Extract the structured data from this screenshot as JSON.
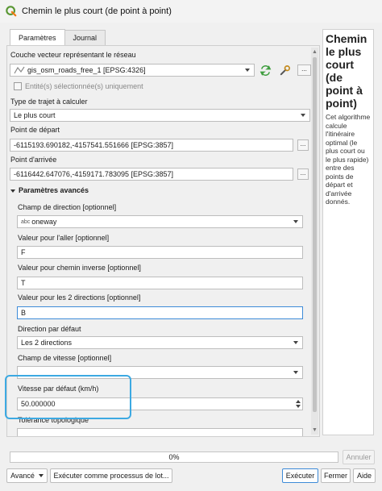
{
  "window": {
    "title": "Chemin le plus court (de point à point)"
  },
  "tabs": [
    {
      "label": "Paramètres"
    },
    {
      "label": "Journal"
    }
  ],
  "form": {
    "network_layer_label": "Couche vecteur représentant le réseau",
    "network_layer_value": "gis_osm_roads_free_1 [EPSG:4326]",
    "selected_only_label": "Entité(s) sélectionnée(s) uniquement",
    "path_type_label": "Type de trajet à calculer",
    "path_type_value": "Le plus court",
    "start_point_label": "Point de départ",
    "start_point_value": "-6115193.690182,-4157541.551666 [EPSG:3857]",
    "end_point_label": "Point d'arrivée",
    "end_point_value": "-6116442.647076,-4159171.783095 [EPSG:3857]",
    "advanced_label": "Paramètres avancés",
    "direction_field_label": "Champ de direction [optionnel]",
    "direction_field_prefix": "abc",
    "direction_field_value": "oneway",
    "forward_label": "Valeur pour l'aller [optionnel]",
    "forward_value": "F",
    "backward_label": "Valeur pour chemin inverse [optionnel]",
    "backward_value": "T",
    "both_label": "Valeur pour les 2 directions [optionnel]",
    "both_value": "B",
    "default_direction_label": "Direction par défaut",
    "default_direction_value": "Les 2 directions",
    "speed_field_label": "Champ de vitesse [optionnel]",
    "speed_field_value": "",
    "default_speed_label": "Vitesse par défaut (km/h)",
    "default_speed_value": "50.000000",
    "tolerance_label": "Tolérance topologique",
    "dots": "..."
  },
  "help": {
    "title": "Chemin le plus court (de point à point)",
    "body": "Cet algorithme calcule l'itinéraire optimal (le plus court ou le plus rapide) entre des points de départ et d'arrivée donnés."
  },
  "progress": {
    "text": "0%",
    "value": 0
  },
  "buttons": {
    "cancel": "Annuler",
    "advanced": "Avancé",
    "batch": "Exécuter comme processus de lot...",
    "run": "Exécuter",
    "close": "Fermer",
    "help": "Aide"
  },
  "colors": {
    "accent": "#3ca9e2",
    "focus": "#3e8bd8",
    "qgis_green": "#589632"
  },
  "icons": [
    "qgis-logo-icon",
    "line-layer-icon",
    "refresh-icon",
    "wrench-icon",
    "chevron-down-icon"
  ]
}
